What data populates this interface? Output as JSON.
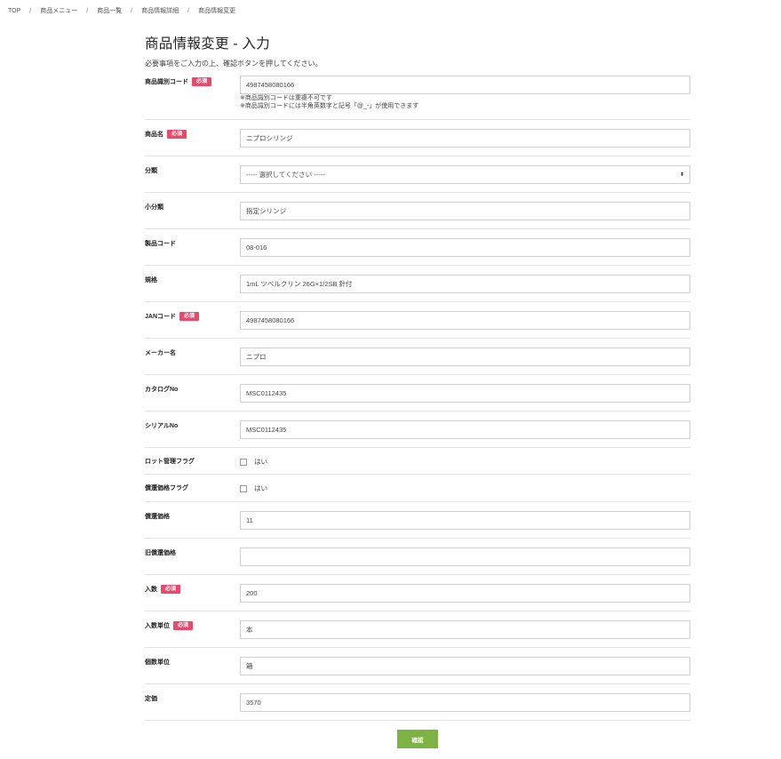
{
  "breadcrumb": [
    {
      "label": "TOP"
    },
    {
      "label": "商品メニュー"
    },
    {
      "label": "商品一覧"
    },
    {
      "label": "商品情報詳細"
    },
    {
      "label": "商品情報変更"
    }
  ],
  "breadcrumb_sep": "/",
  "page": {
    "title": "商品情報変更 - 入力",
    "lead": "必要事項をご入力の上、確認ボタンを押してください。"
  },
  "required_label": "必須",
  "fields": {
    "product_id_code": {
      "label": "商品識別コード",
      "value": "4987458080166",
      "hints": [
        "※商品識別コードは重複不可です",
        "※商品識別コードには半角英数字と記号「@_-」が使用できます"
      ]
    },
    "product_name": {
      "label": "商品名",
      "value": "ニプロシリンジ"
    },
    "category": {
      "label": "分類",
      "selected": "----- 選択してください -----"
    },
    "subcategory": {
      "label": "小分類",
      "value": "指定シリンジ"
    },
    "product_code": {
      "label": "製品コード",
      "value": "08-016"
    },
    "spec": {
      "label": "規格",
      "value": "1mL ツベルクリン 26G×1/2SB 針付"
    },
    "jan_code": {
      "label": "JANコード",
      "value": "4987458080166"
    },
    "maker_name": {
      "label": "メーカー名",
      "value": "ニプロ"
    },
    "catalog_no": {
      "label": "カタログNo",
      "value": "MSC0112435"
    },
    "serial_no": {
      "label": "シリアルNo",
      "value": "MSC0112435"
    },
    "lot_flag": {
      "label": "ロット管理フラグ",
      "option_label": "はい",
      "checked": false
    },
    "reimburse_flag": {
      "label": "償還価格フラグ",
      "option_label": "はい",
      "checked": false
    },
    "reimburse_price": {
      "label": "償還価格",
      "value": "11"
    },
    "old_reimburse_price": {
      "label": "旧償還価格",
      "value": ""
    },
    "quantity": {
      "label": "入数",
      "value": "200"
    },
    "quantity_unit": {
      "label": "入数単位",
      "value": "本"
    },
    "piece_unit": {
      "label": "個数単位",
      "value": "箱"
    },
    "list_price": {
      "label": "定価",
      "value": "3570"
    }
  },
  "submit_label": "確認"
}
